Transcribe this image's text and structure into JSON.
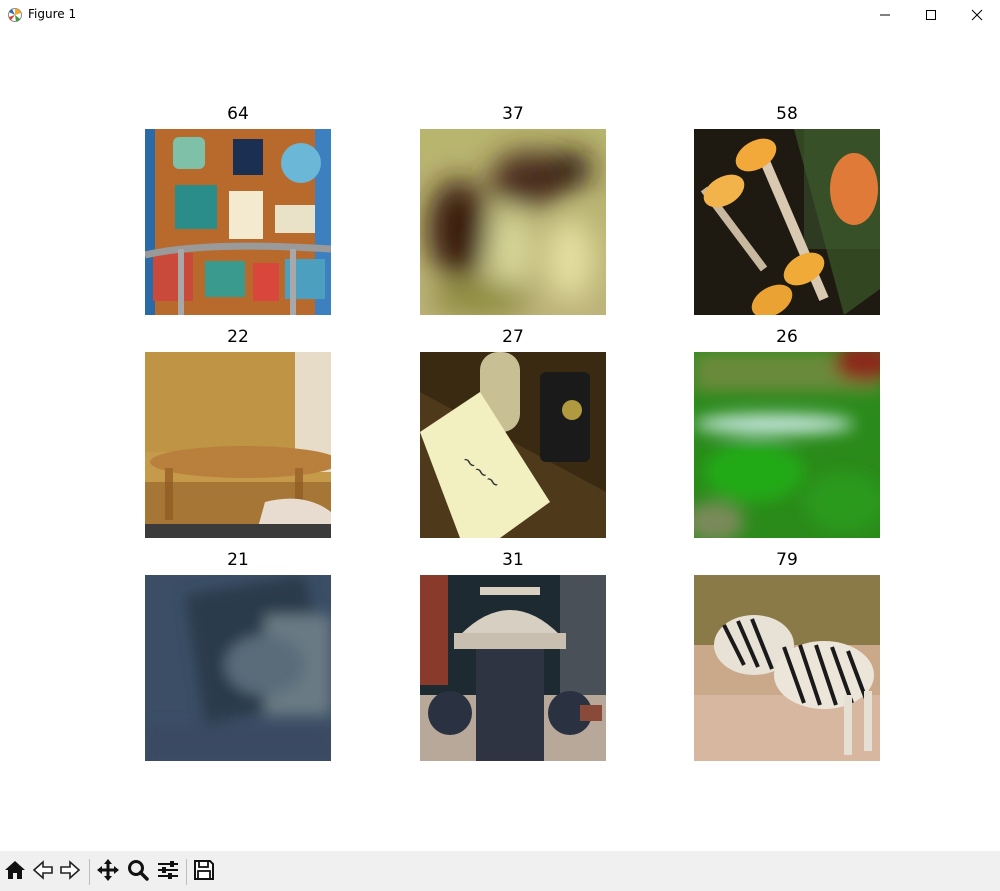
{
  "window": {
    "title": "Figure 1",
    "icon": "matplotlib-figure-icon",
    "controls": [
      "minimize-icon",
      "maximize-icon",
      "close-icon"
    ]
  },
  "figure": {
    "panels": [
      {
        "label": "64",
        "content": "suitcase-with-travel-stickers"
      },
      {
        "label": "37",
        "content": "blurred-image"
      },
      {
        "label": "58",
        "content": "skateboard-wheels"
      },
      {
        "label": "22",
        "content": "wooden-table"
      },
      {
        "label": "27",
        "content": "snack-package-on-table"
      },
      {
        "label": "26",
        "content": "blurred-green-image"
      },
      {
        "label": "21",
        "content": "blurred-dark-image"
      },
      {
        "label": "31",
        "content": "fire-hydrant"
      },
      {
        "label": "79",
        "content": "zebras-fighting"
      }
    ]
  },
  "toolbar": {
    "buttons": [
      "home-icon",
      "back-icon",
      "forward-icon",
      "pan-icon",
      "zoom-icon",
      "configure-subplots-icon",
      "save-icon"
    ]
  }
}
